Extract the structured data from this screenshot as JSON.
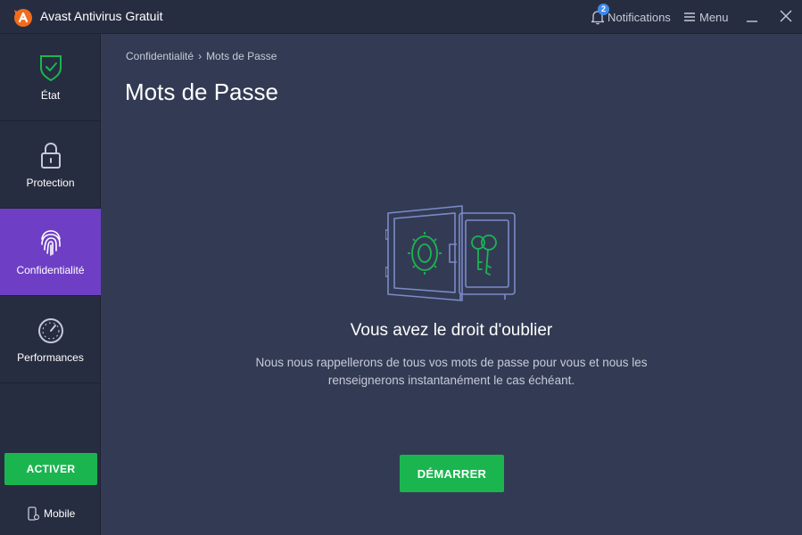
{
  "app": {
    "title": "Avast Antivirus Gratuit"
  },
  "titlebar": {
    "notifications_label": "Notifications",
    "notifications_count": "2",
    "menu_label": "Menu"
  },
  "sidebar": {
    "items": [
      {
        "label": "État",
        "icon": "shield-check-icon"
      },
      {
        "label": "Protection",
        "icon": "lock-icon"
      },
      {
        "label": "Confidentialité",
        "icon": "fingerprint-icon",
        "active": true
      },
      {
        "label": "Performances",
        "icon": "speedometer-icon"
      }
    ],
    "activate_label": "ACTIVER",
    "mobile_label": "Mobile"
  },
  "main": {
    "breadcrumb": [
      "Confidentialité",
      "Mots de Passe"
    ],
    "breadcrumb_separator": "›",
    "title": "Mots de Passe",
    "headline": "Vous avez le droit d'oublier",
    "description": "Nous nous rappellerons de tous vos mots de passe pour vous et nous les renseignerons instantanément le cas échéant.",
    "start_label": "DÉMARRER"
  },
  "colors": {
    "background": "#333b54",
    "sidebar": "#272d40",
    "active_item": "#6e3fc4",
    "accent_green": "#1bb550",
    "logo_orange": "#f26b1d",
    "badge_blue": "#3d8aef"
  }
}
